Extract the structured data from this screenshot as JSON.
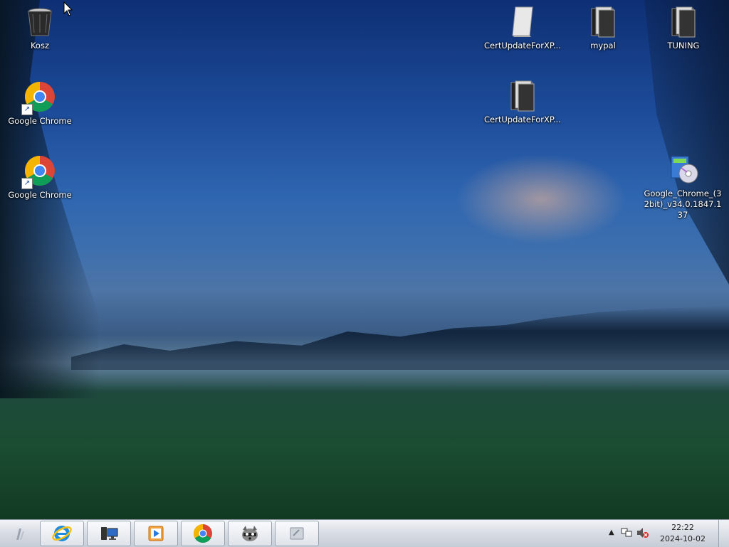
{
  "desktop_icons": [
    {
      "label": "Kosz",
      "icon": "recycle-bin-icon"
    },
    {
      "label": "Google Chrome",
      "icon": "chrome-icon"
    },
    {
      "label": "Google Chrome",
      "icon": "chrome-icon"
    },
    {
      "label": "CertUpdateForXP...",
      "icon": "file-icon"
    },
    {
      "label": "mypal",
      "icon": "folder-icon"
    },
    {
      "label": "TUNING",
      "icon": "folder-icon"
    },
    {
      "label": "CertUpdateForXP...",
      "icon": "folder-icon"
    },
    {
      "label": "Google_Chrome_(32bit)_v34.0.1847.137",
      "icon": "installer-icon"
    }
  ],
  "taskbar": {
    "pinned": [
      {
        "icon": "internet-explorer-icon"
      },
      {
        "icon": "computer-icon"
      },
      {
        "icon": "media-player-icon"
      },
      {
        "icon": "chrome-icon"
      },
      {
        "icon": "raccoon-icon"
      },
      {
        "icon": "window-icon"
      }
    ]
  },
  "tray": {
    "time": "22:22",
    "date": "2024-10-02",
    "icons": [
      "show-hidden-icons-arrow",
      "network-icon",
      "volume-muted-icon"
    ]
  }
}
